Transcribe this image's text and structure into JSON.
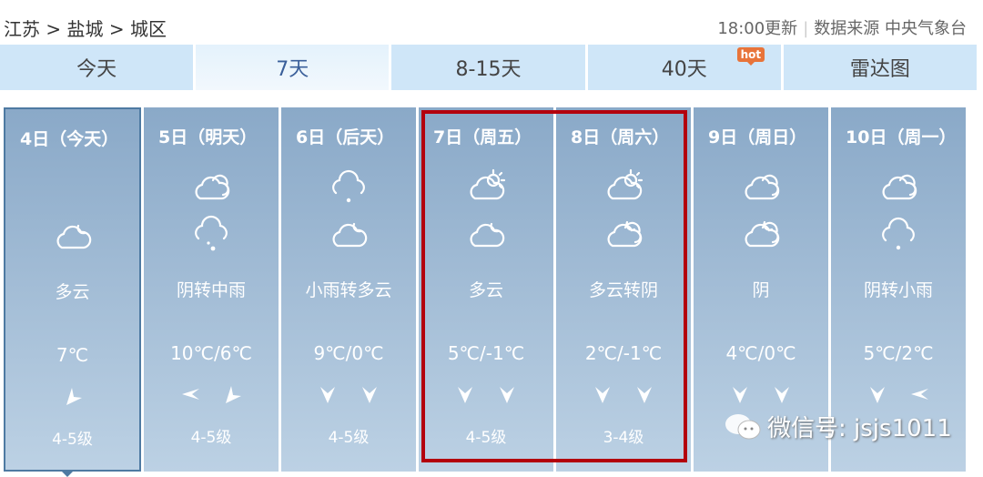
{
  "breadcrumb": "江苏 > 盐城 > 城区",
  "meta": {
    "update": "18:00更新",
    "source": "数据来源 中央气象台"
  },
  "tabs": [
    {
      "label": "今天"
    },
    {
      "label": "7天",
      "active": true
    },
    {
      "label": "8-15天"
    },
    {
      "label": "40天",
      "badge": "hot"
    },
    {
      "label": "雷达图"
    }
  ],
  "days": [
    {
      "title": "4日（今天）",
      "icon_day": "",
      "icon_night": "partly-cloudy-night-icon",
      "desc": "多云",
      "temp": "7℃",
      "wind": [
        "northeast"
      ],
      "level": "4-5级"
    },
    {
      "title": "5日（明天）",
      "icon_day": "overcast-icon",
      "icon_night": "rain-icon",
      "desc": "阴转中雨",
      "temp": "10℃/6℃",
      "wind": [
        "east",
        "northeast"
      ],
      "level": "4-5级"
    },
    {
      "title": "6日（后天）",
      "icon_day": "light-rain-icon",
      "icon_night": "partly-cloudy-night-icon",
      "desc": "小雨转多云",
      "temp": "9℃/0℃",
      "wind": [
        "north",
        "north"
      ],
      "level": "4-5级"
    },
    {
      "title": "7日（周五）",
      "icon_day": "partly-cloudy-day-icon",
      "icon_night": "partly-cloudy-night-icon",
      "desc": "多云",
      "temp": "5℃/-1℃",
      "wind": [
        "north",
        "north"
      ],
      "level": "4-5级"
    },
    {
      "title": "8日（周六）",
      "icon_day": "partly-cloudy-day-icon",
      "icon_night": "overcast-night-icon",
      "desc": "多云转阴",
      "temp": "2℃/-1℃",
      "wind": [
        "north",
        "north"
      ],
      "level": "3-4级"
    },
    {
      "title": "9日（周日）",
      "icon_day": "overcast-icon",
      "icon_night": "overcast-night-icon",
      "desc": "阴",
      "temp": "4℃/0℃",
      "wind": [
        "north",
        "north"
      ],
      "level": ""
    },
    {
      "title": "10日（周一）",
      "icon_day": "overcast-icon",
      "icon_night": "light-rain-icon",
      "desc": "阴转小雨",
      "temp": "5℃/2℃",
      "wind": [
        "north",
        "east"
      ],
      "level": ""
    }
  ],
  "watermark": "微信号: jsjs1011",
  "colors": {
    "highlight": "#b3000d",
    "hot_badge": "#e8743a",
    "active_tab_text": "#3a5f9a"
  }
}
